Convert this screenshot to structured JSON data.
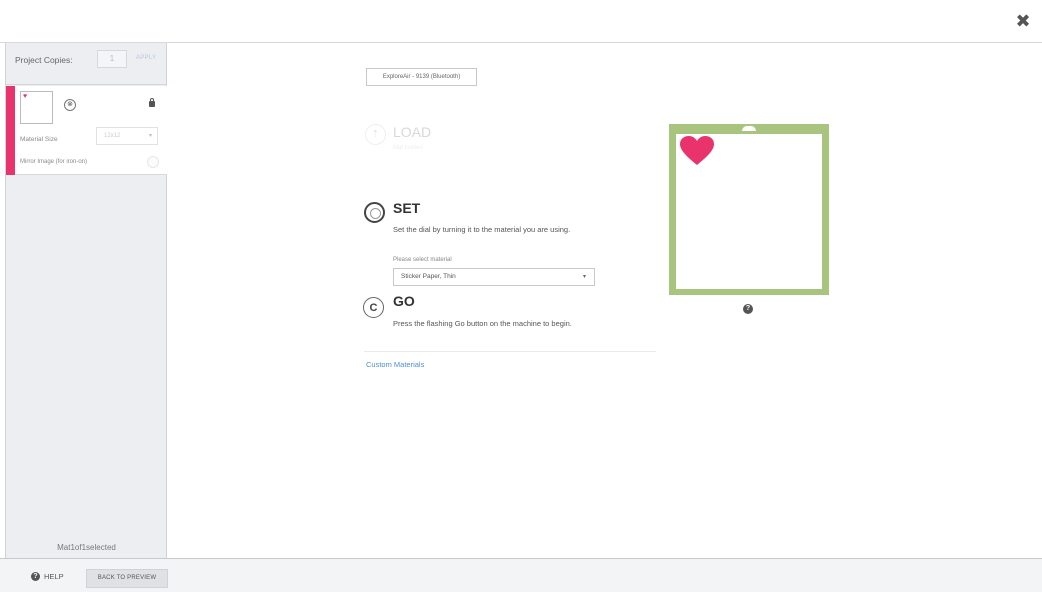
{
  "topbar": {
    "close_symbol": "✖"
  },
  "sidebar": {
    "copies_label": "Project Copies:",
    "copies_value": "1",
    "apply_label": "APPLY",
    "mat_card": {
      "badge_symbol": "⊗",
      "material_size_label": "Material Size",
      "material_size_value": "12x12",
      "mirror_label": "Mirror Image (for iron-on)"
    },
    "mat_count": "Mat1of1selected"
  },
  "bottom": {
    "help_symbol": "?",
    "help_label": "HELP",
    "back_label": "BACK TO PREVIEW"
  },
  "main": {
    "device_label": "ExploreAir - 9139 (Bluetooth)",
    "load": {
      "title": "LOAD",
      "subtitle": "Mat loaded",
      "icon_symbol": "⇡"
    },
    "set": {
      "title": "SET",
      "description": "Set the dial by turning it to the material you are using.",
      "select_label": "Please select material",
      "selected_material": "Sticker Paper, Thin"
    },
    "go": {
      "title": "GO",
      "icon_symbol": "C",
      "description": "Press the flashing Go button on the machine to begin."
    },
    "custom_materials": "Custom Materials"
  },
  "preview": {
    "mat_color": "#a8c47e",
    "heart_color": "#e8336c",
    "info_symbol": "?"
  },
  "accent": "#e8336c"
}
